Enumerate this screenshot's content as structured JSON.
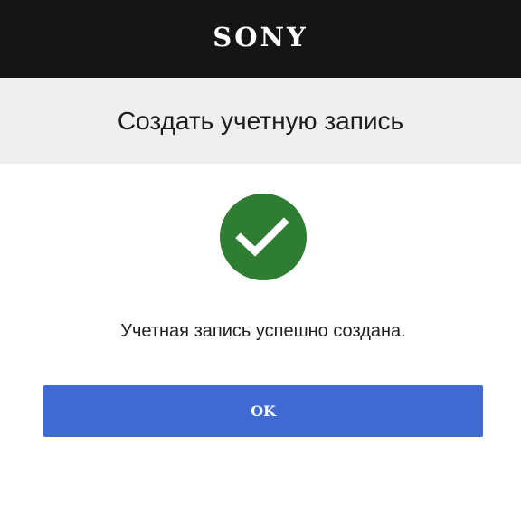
{
  "header": {
    "brand": "SONY",
    "background_color": "#151515"
  },
  "title_band": {
    "title": "Создать учетную запись",
    "background_color": "#efefef"
  },
  "status": {
    "icon": "check-circle-icon",
    "icon_color": "#2e7d32",
    "message": "Учетная запись успешно создана."
  },
  "actions": {
    "ok_label": "OK",
    "ok_color": "#4169d2"
  }
}
